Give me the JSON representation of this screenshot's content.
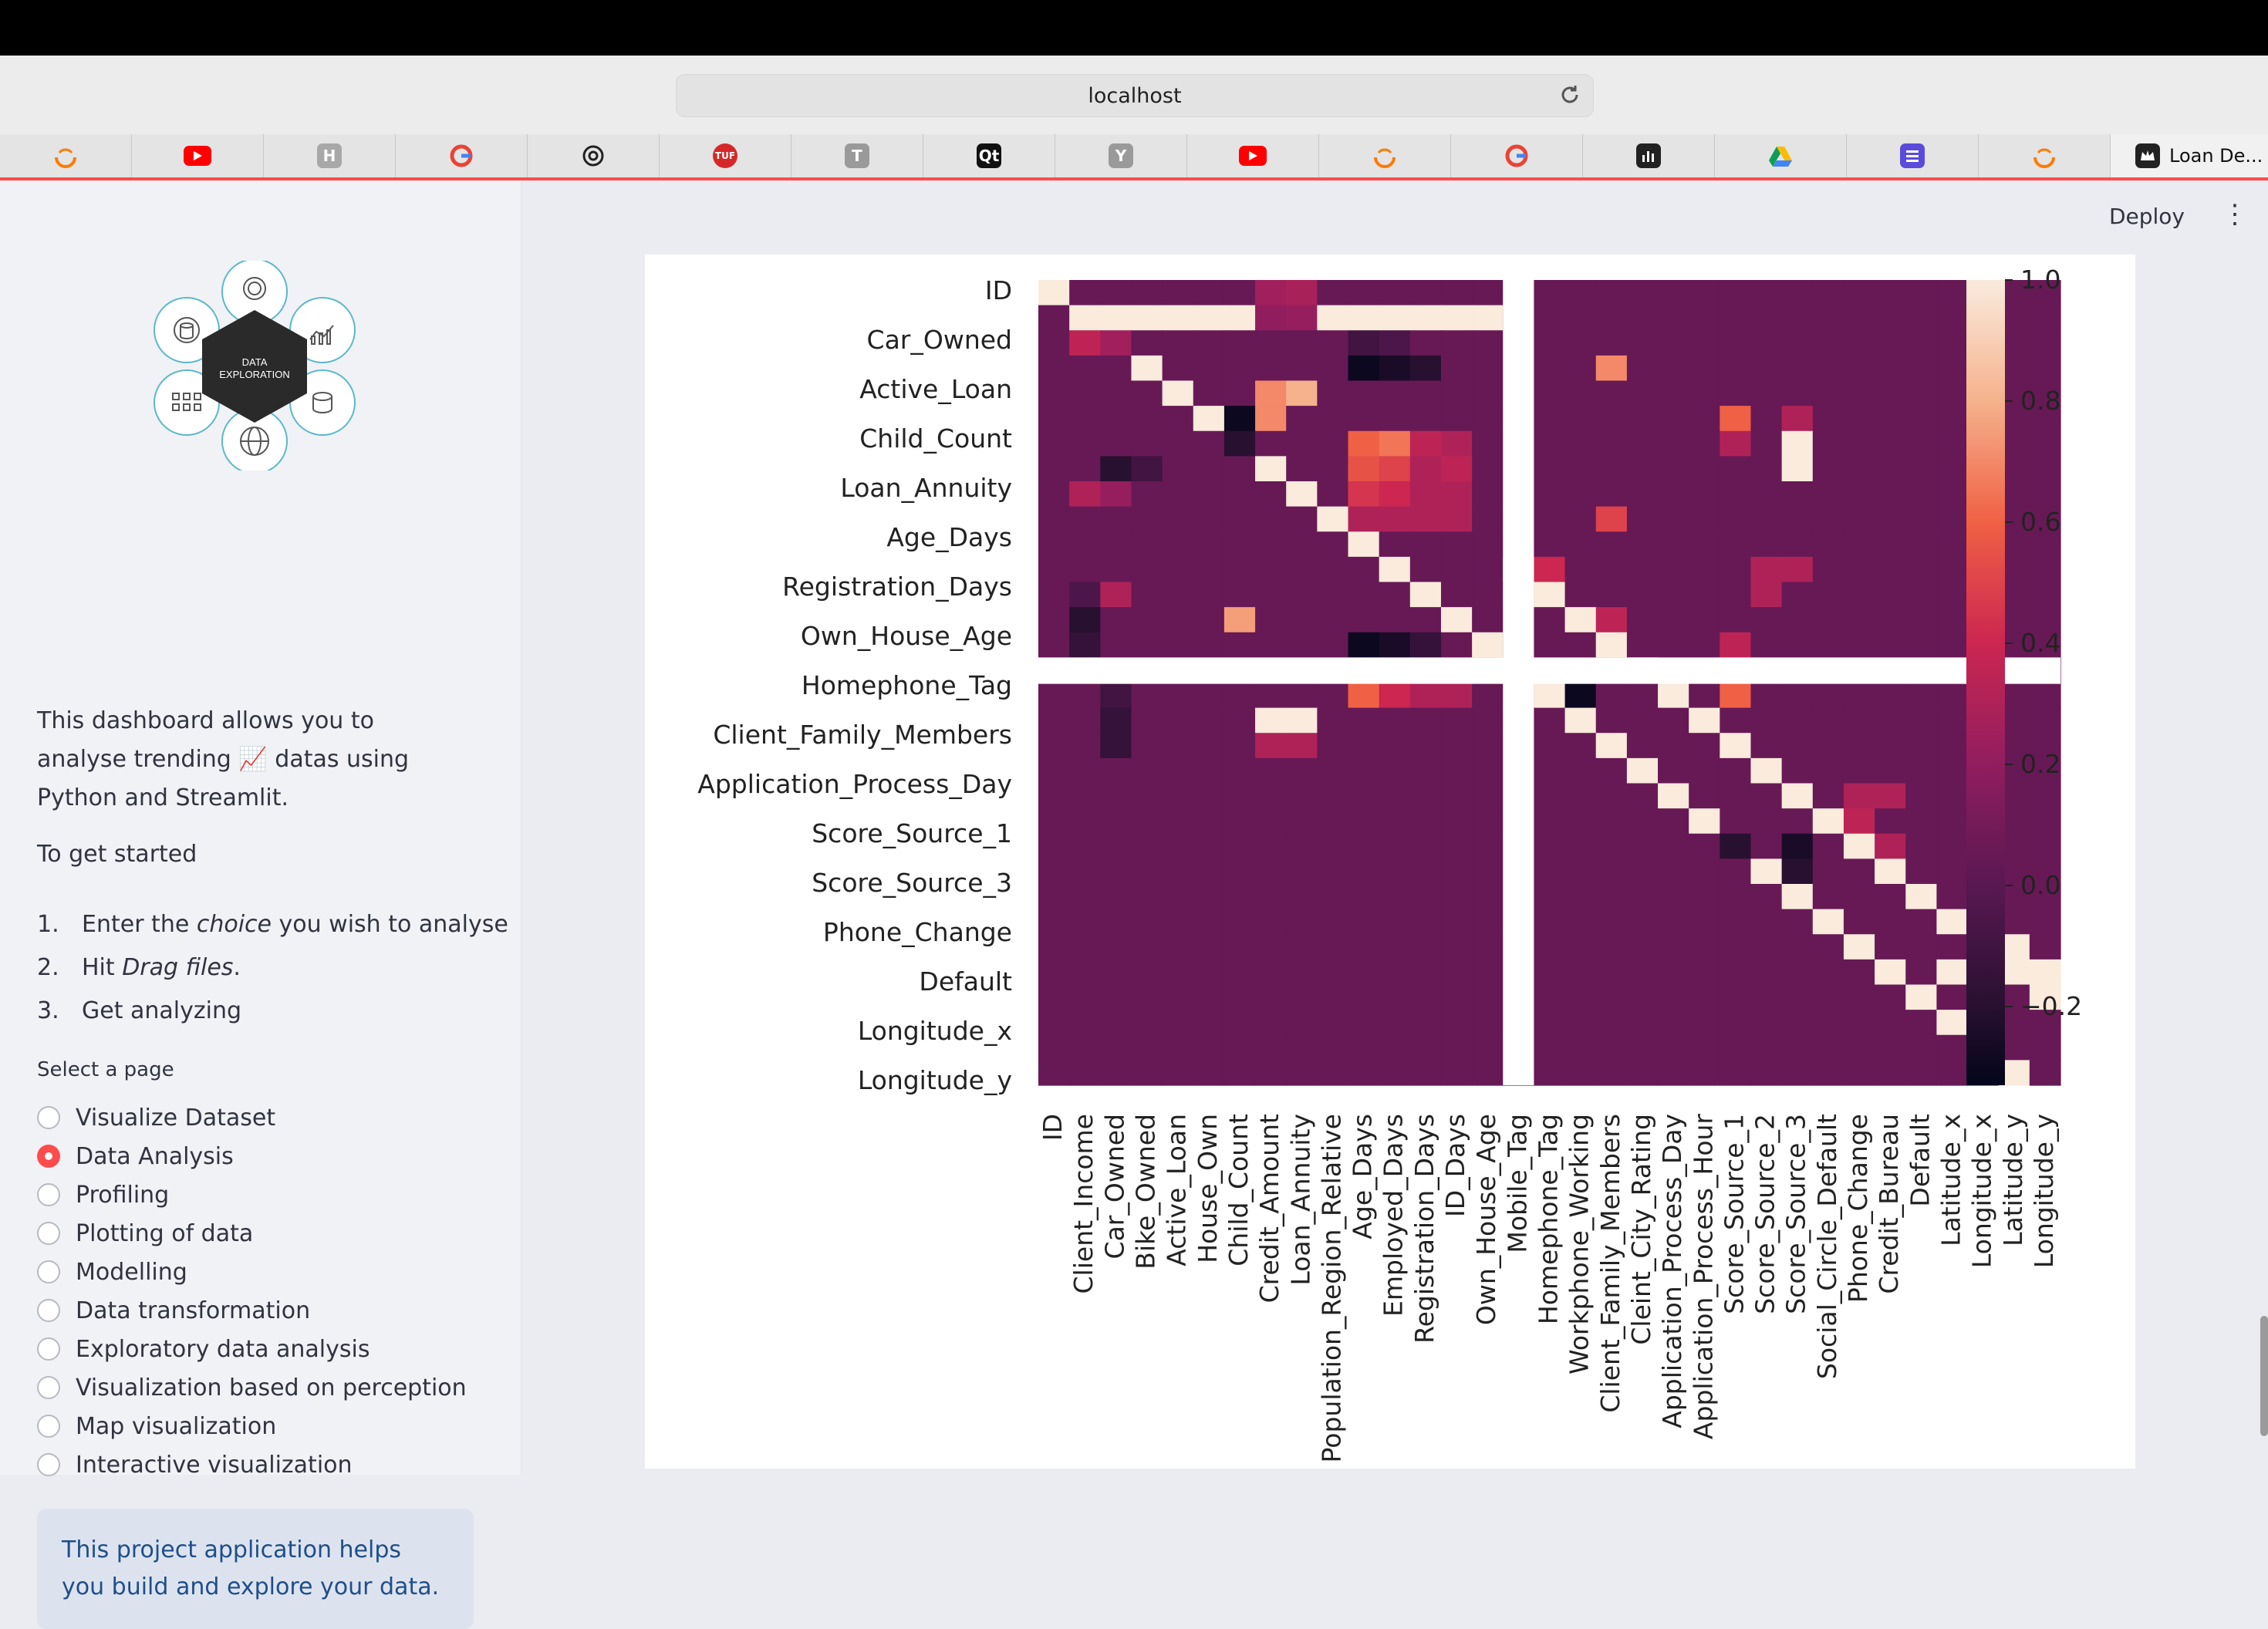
{
  "browser": {
    "url": "localhost",
    "active_tab_title": "Loan De..."
  },
  "tabs": [
    {
      "icon": "orange-arc-icon",
      "color": "#ff7a00"
    },
    {
      "icon": "youtube-icon",
      "color": "#ff0000"
    },
    {
      "icon": "h-letter-icon",
      "color": "#a8a8a8",
      "letter": "H"
    },
    {
      "icon": "google-icon",
      "color": "#4285f4"
    },
    {
      "icon": "openai-icon",
      "color": "#222222"
    },
    {
      "icon": "tuf-icon",
      "color": "#d62828",
      "letter": "TUF"
    },
    {
      "icon": "t-letter-icon",
      "color": "#9a9a9a",
      "letter": "T"
    },
    {
      "icon": "qt-icon",
      "color": "#111111",
      "letter": "Qt"
    },
    {
      "icon": "y-letter-icon",
      "color": "#9a9a9a",
      "letter": "Y"
    },
    {
      "icon": "youtube-icon",
      "color": "#ff0000"
    },
    {
      "icon": "orange-arc-icon",
      "color": "#ff7a00"
    },
    {
      "icon": "google-icon",
      "color": "#4285f4"
    },
    {
      "icon": "bar-chart-icon",
      "color": "#222222"
    },
    {
      "icon": "google-drive-icon",
      "color": "#0f9d58"
    },
    {
      "icon": "list-icon",
      "color": "#5b4bdb"
    },
    {
      "icon": "orange-arc-icon",
      "color": "#ff7a00"
    }
  ],
  "header": {
    "deploy_label": "Deploy"
  },
  "sidebar": {
    "logo_text": "DATA EXPLORATION",
    "description_before": "This dashboard allows you to analyse trending ",
    "description_emoji": "📈",
    "description_after": " datas using Python and Streamlit.",
    "get_started": "To get started",
    "steps": [
      {
        "num": "1.",
        "pre": "Enter the ",
        "em": "choice",
        "post": " you wish to analyse"
      },
      {
        "num": "2.",
        "pre": "Hit ",
        "em": "Drag files",
        "post": "."
      },
      {
        "num": "3.",
        "pre": "Get analyzing",
        "em": "",
        "post": ""
      }
    ],
    "select_label": "Select a page",
    "pages": [
      "Visualize Dataset",
      "Data Analysis",
      "Profiling",
      "Plotting of data",
      "Modelling",
      "Data transformation",
      "Exploratory data analysis",
      "Visualization based on perception",
      "Map visualization",
      "Interactive visualization"
    ],
    "selected_page": "Data Analysis",
    "info": "This project application helps you build and explore your data."
  },
  "chart_data": {
    "type": "heatmap",
    "title": "",
    "row_labels": [
      "ID",
      "Car_Owned",
      "Active_Loan",
      "Child_Count",
      "Loan_Annuity",
      "Age_Days",
      "Registration_Days",
      "Own_House_Age",
      "Homephone_Tag",
      "Client_Family_Members",
      "Application_Process_Day",
      "Score_Source_1",
      "Score_Source_3",
      "Phone_Change",
      "Default",
      "Longitude_x",
      "Longitude_y"
    ],
    "column_labels": [
      "ID",
      "Client_Income",
      "Car_Owned",
      "Bike_Owned",
      "Active_Loan",
      "House_Own",
      "Child_Count",
      "Credit_Amount",
      "Loan_Annuity",
      "Population_Region_Relative",
      "Age_Days",
      "Employed_Days",
      "Registration_Days",
      "ID_Days",
      "Own_House_Age",
      "Mobile_Tag",
      "Homephone_Tag",
      "Workphone_Working",
      "Client_Family_Members",
      "Cleint_City_Rating",
      "Application_Process_Day",
      "Application_Process_Hour",
      "Score_Source_1",
      "Score_Source_2",
      "Score_Source_3",
      "Social_Circle_Default",
      "Phone_Change",
      "Credit_Bureau",
      "Default",
      "Latitude_x",
      "Longitude_x",
      "Latitude_y",
      "Longitude_y"
    ],
    "colorbar": {
      "ticks": [
        1.0,
        0.8,
        0.6,
        0.4,
        0.2,
        0.0,
        -0.2
      ],
      "tick_labels": [
        "1.0",
        "0.8",
        "0.6",
        "0.4",
        "0.2",
        "0.0",
        "−0.2"
      ],
      "vmin": -0.33,
      "vmax": 1.0,
      "colormap": "rocket"
    },
    "background": 0.05,
    "highlights": [
      [
        0,
        0,
        1.0
      ],
      [
        1,
        1,
        1.0
      ],
      [
        1,
        2,
        1.0
      ],
      [
        1,
        3,
        1.0
      ],
      [
        1,
        4,
        1.0
      ],
      [
        1,
        5,
        1.0
      ],
      [
        1,
        6,
        1.0
      ],
      [
        1,
        7,
        1.0
      ],
      [
        1,
        8,
        1.0
      ],
      [
        1,
        9,
        1.0
      ],
      [
        1,
        10,
        1.0
      ],
      [
        1,
        11,
        1.0
      ],
      [
        1,
        12,
        1.0
      ],
      [
        1,
        13,
        1.0
      ],
      [
        1,
        14,
        1.0
      ],
      [
        2,
        1,
        0.35
      ],
      [
        2,
        2,
        0.25
      ],
      [
        8,
        1,
        0.3
      ],
      [
        8,
        2,
        0.22
      ],
      [
        0,
        7,
        0.25
      ],
      [
        0,
        8,
        0.28
      ],
      [
        1,
        7,
        0.2
      ],
      [
        1,
        8,
        0.22
      ],
      [
        2,
        10,
        -0.1
      ],
      [
        2,
        11,
        -0.05
      ],
      [
        3,
        10,
        -0.3
      ],
      [
        3,
        11,
        -0.25
      ],
      [
        3,
        12,
        -0.2
      ],
      [
        4,
        7,
        0.7
      ],
      [
        4,
        8,
        0.8
      ],
      [
        5,
        7,
        0.7
      ],
      [
        6,
        10,
        0.6
      ],
      [
        6,
        11,
        0.65
      ],
      [
        6,
        12,
        0.35
      ],
      [
        6,
        13,
        0.3
      ],
      [
        7,
        10,
        0.55
      ],
      [
        7,
        11,
        0.5
      ],
      [
        7,
        12,
        0.3
      ],
      [
        7,
        13,
        0.35
      ],
      [
        8,
        10,
        0.45
      ],
      [
        8,
        11,
        0.4
      ],
      [
        8,
        12,
        0.3
      ],
      [
        8,
        13,
        0.3
      ],
      [
        9,
        10,
        0.3
      ],
      [
        9,
        11,
        0.3
      ],
      [
        9,
        12,
        0.3
      ],
      [
        9,
        13,
        0.3
      ],
      [
        7,
        2,
        -0.2
      ],
      [
        7,
        3,
        -0.1
      ],
      [
        5,
        6,
        -0.3
      ],
      [
        6,
        6,
        -0.2
      ],
      [
        12,
        1,
        -0.05
      ],
      [
        12,
        2,
        0.3
      ],
      [
        13,
        1,
        -0.2
      ],
      [
        14,
        1,
        -0.15
      ],
      [
        13,
        6,
        0.75
      ],
      [
        13,
        7,
        0.05
      ],
      [
        14,
        10,
        -0.3
      ],
      [
        14,
        11,
        -0.25
      ],
      [
        14,
        12,
        -0.15
      ],
      [
        16,
        10,
        0.6
      ],
      [
        16,
        11,
        0.4
      ],
      [
        16,
        12,
        0.3
      ],
      [
        16,
        13,
        0.3
      ],
      [
        17,
        7,
        1.0
      ],
      [
        17,
        8,
        1.0
      ],
      [
        18,
        7,
        0.3
      ],
      [
        18,
        8,
        0.3
      ],
      [
        11,
        15,
        1.0
      ],
      [
        12,
        16,
        1.0
      ],
      [
        13,
        17,
        1.0
      ],
      [
        14,
        18,
        1.0
      ],
      [
        15,
        19,
        1.0
      ],
      [
        16,
        20,
        1.0
      ],
      [
        17,
        21,
        1.0
      ],
      [
        18,
        22,
        1.0
      ],
      [
        19,
        23,
        1.0
      ],
      [
        20,
        24,
        1.0
      ],
      [
        21,
        25,
        1.0
      ],
      [
        22,
        26,
        1.0
      ],
      [
        23,
        27,
        1.0
      ],
      [
        24,
        28,
        1.0
      ],
      [
        11,
        16,
        0.4
      ],
      [
        12,
        15,
        0.4
      ],
      [
        13,
        18,
        0.35
      ],
      [
        15,
        16,
        -0.3
      ],
      [
        15,
        17,
        -0.3
      ],
      [
        16,
        17,
        -0.3
      ],
      [
        11,
        23,
        0.3
      ],
      [
        11,
        24,
        0.3
      ],
      [
        12,
        23,
        0.3
      ],
      [
        14,
        22,
        0.35
      ],
      [
        15,
        22,
        0.3
      ],
      [
        16,
        22,
        0.6
      ],
      [
        5,
        22,
        0.6
      ],
      [
        5,
        24,
        0.3
      ],
      [
        6,
        22,
        0.3
      ],
      [
        3,
        18,
        0.7
      ],
      [
        9,
        18,
        0.5
      ],
      [
        6,
        24,
        1.0
      ],
      [
        7,
        24,
        1.0
      ],
      [
        25,
        29,
        1.0
      ],
      [
        25,
        30,
        1.0
      ],
      [
        26,
        30,
        1.0
      ],
      [
        26,
        31,
        1.0
      ],
      [
        27,
        29,
        1.0
      ],
      [
        27,
        31,
        1.0
      ],
      [
        27,
        32,
        1.0
      ],
      [
        28,
        30,
        1.0
      ],
      [
        28,
        32,
        1.0
      ],
      [
        20,
        26,
        0.3
      ],
      [
        20,
        27,
        0.3
      ],
      [
        21,
        26,
        0.35
      ],
      [
        22,
        27,
        0.3
      ],
      [
        16,
        2,
        -0.1
      ],
      [
        17,
        2,
        -0.15
      ],
      [
        18,
        2,
        -0.15
      ],
      [
        22,
        22,
        -0.2
      ],
      [
        23,
        24,
        -0.2
      ],
      [
        22,
        24,
        -0.25
      ]
    ]
  }
}
